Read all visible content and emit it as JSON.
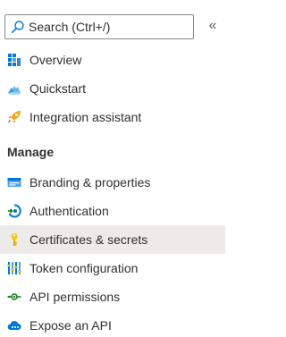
{
  "search": {
    "placeholder": "Search (Ctrl+/)",
    "icon": "search-icon"
  },
  "collapse": {
    "glyph": "«",
    "icon": "double-chevron-left-icon"
  },
  "items_top": [
    {
      "label": "Overview",
      "icon": "overview-grid-icon"
    },
    {
      "label": "Quickstart",
      "icon": "cloud-quickstart-icon"
    },
    {
      "label": "Integration assistant",
      "icon": "rocket-icon"
    }
  ],
  "section": {
    "label": "Manage"
  },
  "items_manage": [
    {
      "label": "Branding & properties",
      "icon": "branding-card-icon"
    },
    {
      "label": "Authentication",
      "icon": "authentication-icon"
    },
    {
      "label": "Certificates & secrets",
      "icon": "key-icon",
      "selected": true
    },
    {
      "label": "Token configuration",
      "icon": "token-bars-icon"
    },
    {
      "label": "API permissions",
      "icon": "api-permissions-icon"
    },
    {
      "label": "Expose an API",
      "icon": "cloud-api-icon"
    }
  ],
  "colors": {
    "selected_background": "#edebe9",
    "text": "#323130",
    "accent_blue": "#0078d4"
  }
}
